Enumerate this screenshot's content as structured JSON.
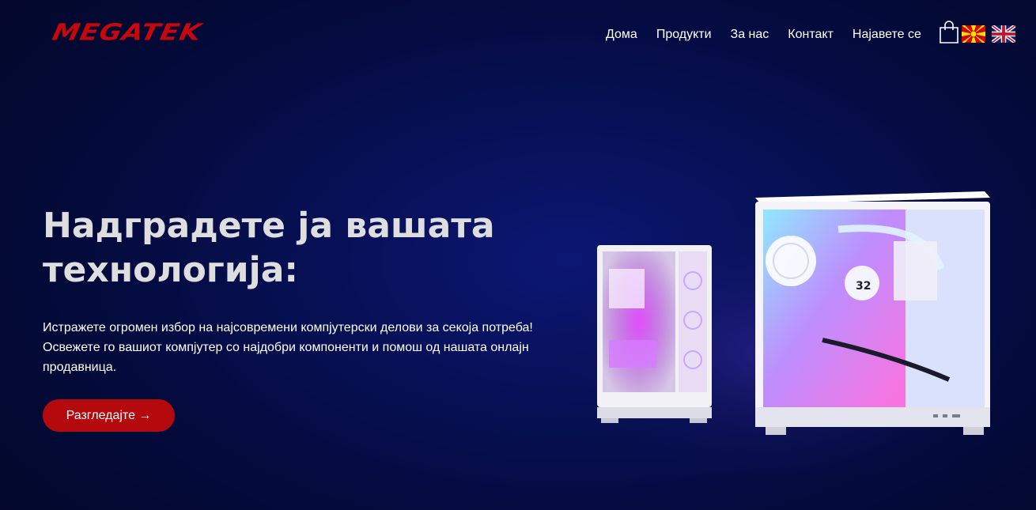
{
  "brand": {
    "logo_text": "MEGATEK",
    "logo_color": "#c8070d"
  },
  "nav": {
    "items": [
      {
        "label": "Дома"
      },
      {
        "label": "Продукти"
      },
      {
        "label": "За нас"
      },
      {
        "label": "Контакт"
      },
      {
        "label": "Најавете се"
      }
    ],
    "cart_icon": "shopping-bag-icon",
    "languages": [
      {
        "icon": "flag-macedonia-icon"
      },
      {
        "icon": "flag-uk-icon"
      }
    ]
  },
  "hero": {
    "title_lines": [
      "Надградете ја вашата",
      "технологија:"
    ],
    "description_lines": [
      "Истражете огромен избор на најсовремени компјутерски делови за секоја потреба!",
      "Освежете го вашиот компјутер со најдобри компоненти и помош од нашата онлајн",
      "продавница."
    ],
    "cta_label": "Разгледајте →",
    "cta_color": "#b40a0d",
    "image_subject": "two-white-pc-cases-rgb"
  },
  "colors": {
    "background": "#050c45",
    "title": "#dedede",
    "text": "#ffffff"
  }
}
